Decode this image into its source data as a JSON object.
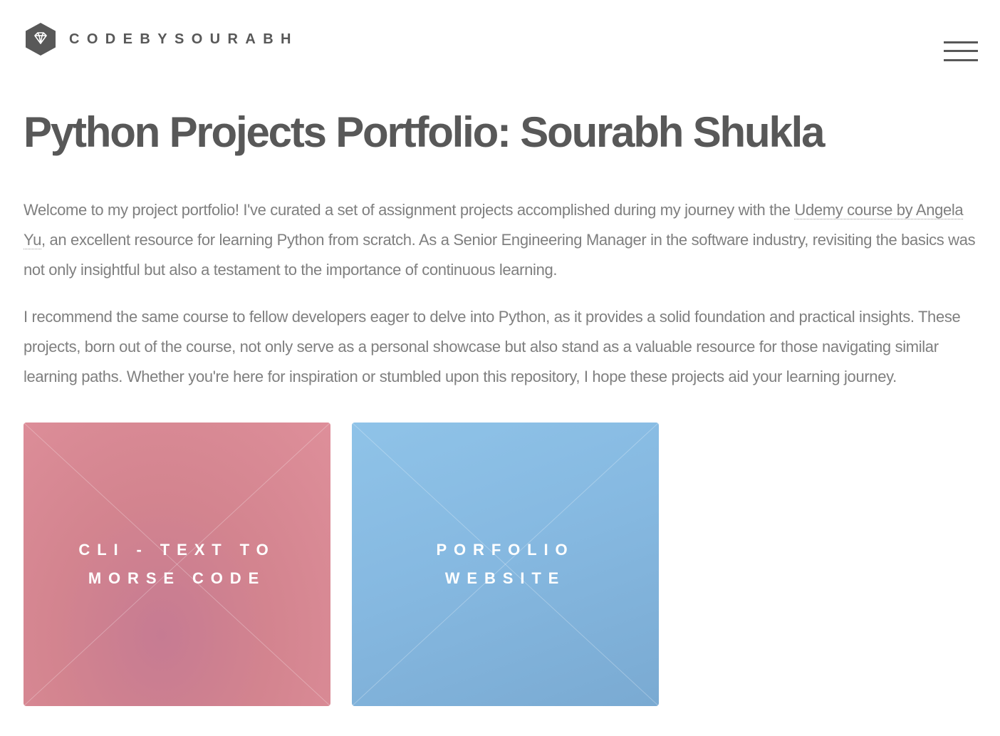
{
  "header": {
    "logo_text": "CODEBYSOURABH",
    "logo_icon": "diamond-icon",
    "menu_icon": "hamburger-menu-icon"
  },
  "main": {
    "title": "Python Projects Portfolio: Sourabh Shukla",
    "paragraph1": {
      "before_link": "Welcome to my project portfolio! I've curated a set of assignment projects accomplished during my journey with the ",
      "link_text": "Udemy course by Angela Yu",
      "after_link": ", an excellent resource for learning Python from scratch. As a Senior Engineering Manager in the software industry, revisiting the basics was not only insightful but also a testament to the importance of continuous learning."
    },
    "paragraph2": "I recommend the same course to fellow developers eager to delve into Python, as it provides a solid foundation and practical insights. These projects, born out of the course, not only serve as a personal showcase but also stand as a valuable resource for those navigating similar learning paths. Whether you're here for inspiration or stumbled upon this repository, I hope these projects aid your learning journey."
  },
  "tiles": [
    {
      "title": "CLI - Text to Morse Code",
      "color": "#d8879a"
    },
    {
      "title": "Porfolio Website",
      "color": "#86b9e1"
    }
  ],
  "colors": {
    "text_dark": "#585858",
    "text_body": "#7f7f7f",
    "background": "#ffffff"
  }
}
